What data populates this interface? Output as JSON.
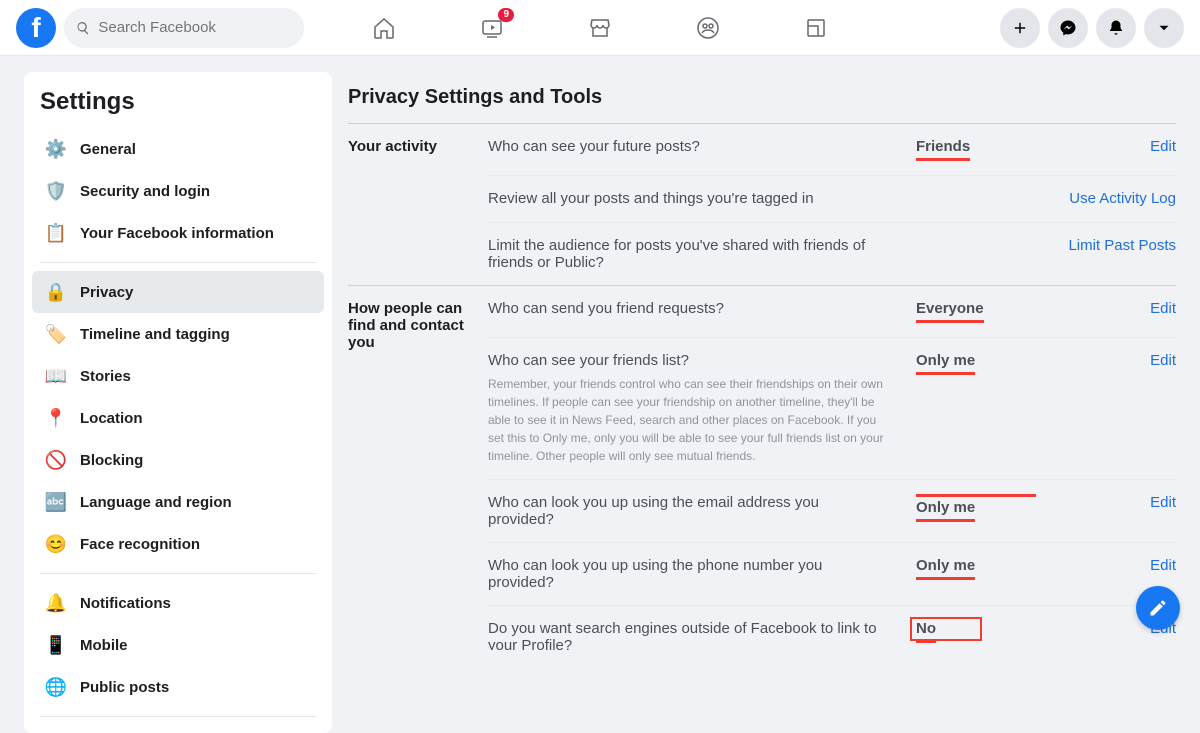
{
  "header": {
    "search_placeholder": "Search Facebook",
    "video_badge": "9"
  },
  "sidebar": {
    "title": "Settings",
    "items": [
      {
        "label": "General",
        "icon": "⚙️"
      },
      {
        "label": "Security and login",
        "icon": "🛡️"
      },
      {
        "label": "Your Facebook information",
        "icon": "📋"
      }
    ],
    "items2": [
      {
        "label": "Privacy",
        "icon": "🔒"
      },
      {
        "label": "Timeline and tagging",
        "icon": "🏷️"
      },
      {
        "label": "Stories",
        "icon": "📖"
      },
      {
        "label": "Location",
        "icon": "📍"
      },
      {
        "label": "Blocking",
        "icon": "🚫"
      },
      {
        "label": "Language and region",
        "icon": "🔤"
      },
      {
        "label": "Face recognition",
        "icon": "😊"
      }
    ],
    "items3": [
      {
        "label": "Notifications",
        "icon": "🔔"
      },
      {
        "label": "Mobile",
        "icon": "📱"
      },
      {
        "label": "Public posts",
        "icon": "🌐"
      }
    ]
  },
  "main": {
    "title": "Privacy Settings and Tools",
    "sections": [
      {
        "title": "Your activity",
        "rows": [
          {
            "q": "Who can see your future posts?",
            "value": "Friends",
            "action": "Edit",
            "hl_under": true
          },
          {
            "q": "Review all your posts and things you're tagged in",
            "value": "",
            "action": "Use Activity Log"
          },
          {
            "q": "Limit the audience for posts you've shared with friends of friends or Public?",
            "value": "",
            "action": "Limit Past Posts"
          }
        ]
      },
      {
        "title": "How people can find and contact you",
        "rows": [
          {
            "q": "Who can send you friend requests?",
            "value": "Everyone",
            "action": "Edit",
            "hl_under": true
          },
          {
            "q": "Who can see your friends list?",
            "sub": "Remember, your friends control who can see their friendships on their own timelines. If people can see your friendship on another timeline, they'll be able to see it in News Feed, search and other places on Facebook. If you set this to Only me, only you will be able to see your full friends list on your timeline. Other people will only see mutual friends.",
            "value": "Only me",
            "action": "Edit",
            "hl_under": true
          },
          {
            "q": "Who can look you up using the email address you provided?",
            "value": "Only me",
            "action": "Edit",
            "hl_over": true,
            "hl_under": true
          },
          {
            "q": "Who can look you up using the phone number you provided?",
            "value": "Only me",
            "action": "Edit",
            "hl_under": true
          },
          {
            "q": "Do you want search engines outside of Facebook to link to your Profile?",
            "value": "No",
            "action": "Edit",
            "hl_box": true,
            "hl_under": true
          }
        ]
      }
    ]
  }
}
